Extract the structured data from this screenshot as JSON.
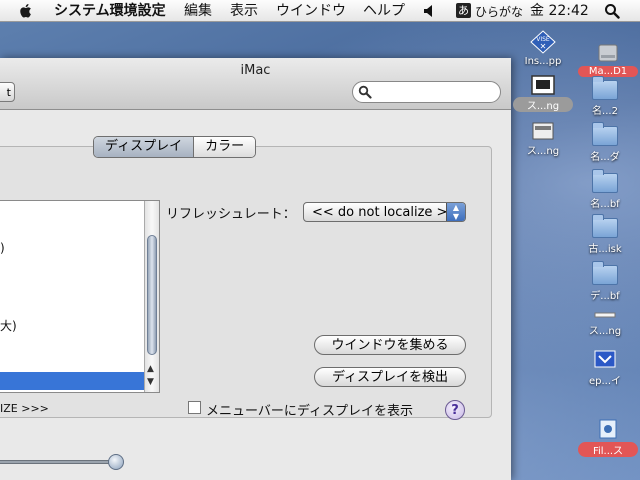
{
  "menubar": {
    "app_name": "システム環境設定",
    "items": [
      "編集",
      "表示",
      "ウインドウ",
      "ヘルプ"
    ],
    "input_mode": "ひらがな",
    "ime_glyph": "あ",
    "clock": "金 22:42"
  },
  "window": {
    "title": "iMac",
    "toolbar_button_label": "t",
    "search_placeholder": ""
  },
  "tabs": [
    {
      "label": "ディスプレイ",
      "selected": true
    },
    {
      "label": "カラー",
      "selected": false
    }
  ],
  "resolution_list": {
    "rows": [
      ")",
      "大)"
    ]
  },
  "refresh": {
    "label": "リフレッシュレート：",
    "value": "<< do not localize >"
  },
  "buttons": {
    "gather_windows": "ウインドウを集める",
    "detect_displays": "ディスプレイを検出"
  },
  "truncated_label": "IZE >>>",
  "menubar_checkbox_label": "メニューバーにディスプレイを表示",
  "help_label": "?",
  "desktop_icons": [
    {
      "label": "Ins...pp",
      "icon": "vise-installer-icon"
    },
    {
      "label": "Ma...D1",
      "icon": "hard-disk-icon"
    },
    {
      "label": "ス...ng",
      "icon": "screenshot-icon"
    },
    {
      "label": "名...2",
      "icon": "folder-icon"
    },
    {
      "label": "ス...ng",
      "icon": "screenshot-icon"
    },
    {
      "label": "名...ダ",
      "icon": "folder-icon"
    },
    {
      "label": "名...bf",
      "icon": "folder-icon"
    },
    {
      "label": "古...isk",
      "icon": "folder-icon"
    },
    {
      "label": "デ...bf",
      "icon": "folder-icon"
    },
    {
      "label": "ス...ng",
      "icon": "screenshot-icon"
    },
    {
      "label": "ep...イ",
      "icon": "application-icon"
    },
    {
      "label": "Fil...ス",
      "icon": "file-icon"
    }
  ]
}
